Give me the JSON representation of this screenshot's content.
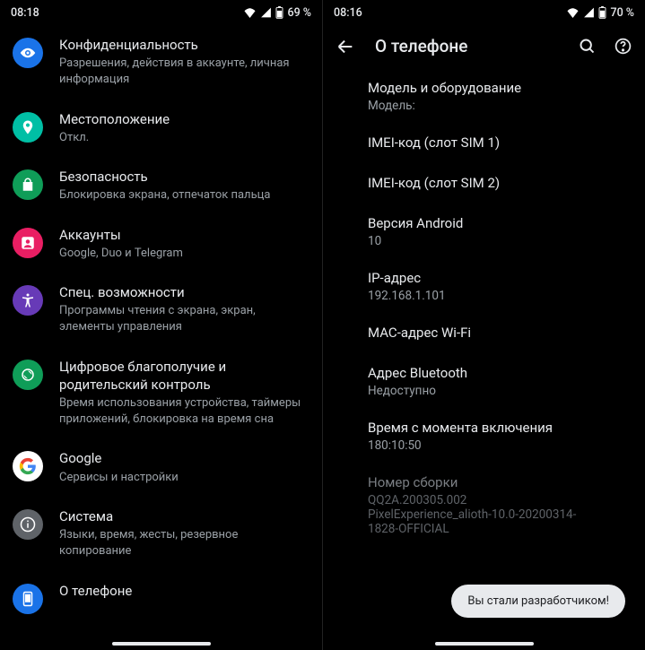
{
  "left": {
    "statusbar": {
      "time": "08:18",
      "battery": "69 %"
    },
    "items": [
      {
        "title": "Конфиденциальность",
        "sub": "Разрешения, действия в аккаунте, личная информация"
      },
      {
        "title": "Местоположение",
        "sub": "Откл."
      },
      {
        "title": "Безопасность",
        "sub": "Блокировка экрана, отпечаток пальца"
      },
      {
        "title": "Аккаунты",
        "sub": "Google, Duo и Telegram"
      },
      {
        "title": "Спец. возможности",
        "sub": "Программы чтения с экрана, экран, элементы управления"
      },
      {
        "title": "Цифровое благополучие и родительский контроль",
        "sub": "Время использования устройства, таймеры приложений, блокировка на время сна"
      },
      {
        "title": "Google",
        "sub": "Сервисы и настройки"
      },
      {
        "title": "Система",
        "sub": "Языки, время, жесты, резервное копирование"
      },
      {
        "title": "О телефоне",
        "sub": ""
      }
    ]
  },
  "right": {
    "statusbar": {
      "time": "08:16",
      "battery": "70 %"
    },
    "title": "О телефоне",
    "blocks": [
      {
        "title": "Модель и оборудование",
        "sub": "Модель:"
      },
      {
        "title": "IMEI-код (слот SIM 1)",
        "sub": ""
      },
      {
        "title": "IMEI-код (слот SIM 2)",
        "sub": ""
      },
      {
        "title": "Версия Android",
        "sub": "10"
      },
      {
        "title": "IP-адрес",
        "sub": "192.168.1.101"
      },
      {
        "title": "MAC-адрес Wi-Fi",
        "sub": ""
      },
      {
        "title": "Адрес Bluetooth",
        "sub": "Недоступно"
      },
      {
        "title": "Время с момента включения",
        "sub": "180:10:50"
      },
      {
        "title": "Номер сборки",
        "sub": "QQ2A.200305.002",
        "sub2": "PixelExperience_alioth-10.0-20200314-1828-OFFICIAL",
        "dim": true
      }
    ],
    "toast": "Вы стали разработчиком!"
  },
  "iconColors": {
    "privacy": "#1a73e8",
    "location": "#00bfa5",
    "security": "#0f9d58",
    "accounts": "#e91e63",
    "accessibility": "#673ab7",
    "wellbeing": "#0f9d58",
    "google": "#1a73e8",
    "system": "#5f6368",
    "about": "#1a73e8"
  }
}
